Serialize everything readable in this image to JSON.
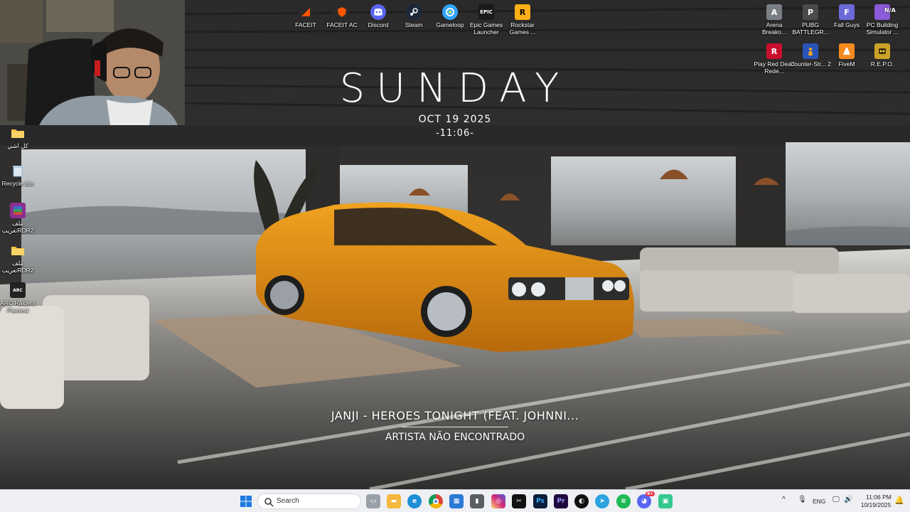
{
  "desktop": {
    "top_icons": [
      {
        "name": "faceit",
        "label": "FACEIT",
        "icon": "faceit-icon",
        "color": "#ff5500"
      },
      {
        "name": "faceit-ac",
        "label": "FACEIT AC",
        "icon": "faceit-ac-icon",
        "color": "#ff5500"
      },
      {
        "name": "discord",
        "label": "Discord",
        "icon": "discord-icon",
        "color": "#5865f2"
      },
      {
        "name": "steam",
        "label": "Steam",
        "icon": "steam-icon",
        "color": "#1b2838"
      },
      {
        "name": "gameloop",
        "label": "Gameloop",
        "icon": "gameloop-icon",
        "color": "#2fa4ff"
      },
      {
        "name": "epic-games",
        "label": "Epic Games Launcher",
        "icon": "epic-games-icon",
        "color": "#1a1a1a"
      },
      {
        "name": "rockstar",
        "label": "Rockstar Games ...",
        "icon": "rockstar-icon",
        "color": "#fcaf17"
      }
    ],
    "right_icons": [
      {
        "name": "arena-breakout",
        "label": "Arena Breako...",
        "icon": "arena-breakout-icon",
        "color": "#7a7f85"
      },
      {
        "name": "pubg",
        "label": "PUBG BATTLEGR...",
        "icon": "pubg-icon",
        "color": "#4a4a48"
      },
      {
        "name": "fall-guys",
        "label": "Fall Guys",
        "icon": "fall-guys-icon",
        "color": "#6a6ad8"
      },
      {
        "name": "pc-building-simulator",
        "label": "PC Building Simulator ...",
        "icon": "pc-building-simulator-icon",
        "color": "#8a5ad8",
        "badge": "N/A"
      },
      {
        "name": "red-dead",
        "label": "Play Red Dead Rede...",
        "icon": "red-dead-icon",
        "color": "#c8102e"
      },
      {
        "name": "counter-strike",
        "label": "Counter-Str... 2",
        "icon": "counter-strike-icon",
        "color": "#2a55b8"
      },
      {
        "name": "fivem",
        "label": "FiveM",
        "icon": "fivem-icon",
        "color": "#f58b1f"
      },
      {
        "name": "repo",
        "label": "R.E.P.O.",
        "icon": "repo-icon",
        "color": "#c9a227"
      }
    ],
    "left_icons": [
      {
        "name": "folder-kol-ashi",
        "label": "كل اشي",
        "icon": "folder-icon",
        "color": "#f5c542"
      },
      {
        "name": "recycle-bin",
        "label": "Recycle Bin",
        "icon": "recycle-bin-icon",
        "color": "#8ab4d8"
      },
      {
        "name": "winrar-rdr2",
        "label": "ملف تعريبRDR2",
        "icon": "winrar-icon",
        "color": "#8b2f8f"
      },
      {
        "name": "folder-rdr2",
        "label": "ملف تعريبRDR2",
        "icon": "folder-icon",
        "color": "#f5c542"
      },
      {
        "name": "arc-raiders",
        "label": "ARC Raiders Playtest",
        "icon": "arc-raiders-icon",
        "color": "#222222"
      }
    ]
  },
  "clock_widget": {
    "day": "SUNDAY",
    "date": "OCT 19 2025",
    "time": "-11:06-"
  },
  "music_widget": {
    "track": "JANJI - HEROES TONIGHT (FEAT. JOHNNI...",
    "artist": "ARTISTA NÃO ENCONTRADO"
  },
  "taskbar": {
    "search_placeholder": "Search",
    "pinned": [
      {
        "name": "task-view",
        "icon": "task-view-icon",
        "color": "#6b6f76"
      },
      {
        "name": "file-explorer",
        "icon": "file-explorer-icon",
        "color": "#f3b83c"
      },
      {
        "name": "edge",
        "icon": "edge-icon",
        "color": "#1d8fd6"
      },
      {
        "name": "chrome",
        "icon": "chrome-icon",
        "color": "#db4437"
      },
      {
        "name": "ms-store",
        "icon": "ms-store-icon",
        "color": "#2a7ad6"
      },
      {
        "name": "usb-device",
        "icon": "usb-icon",
        "color": "#5a5d63"
      },
      {
        "name": "instagram",
        "icon": "instagram-icon",
        "color": "#d6249f"
      },
      {
        "name": "capcut",
        "icon": "capcut-icon",
        "color": "#111111"
      },
      {
        "name": "photoshop",
        "icon": "photoshop-icon",
        "color": "#0b1d3a",
        "text": "Ps"
      },
      {
        "name": "premiere",
        "icon": "premiere-icon",
        "color": "#1f0a3c",
        "text": "Pr"
      },
      {
        "name": "app-blob",
        "icon": "chat-app-icon",
        "color": "#111111"
      },
      {
        "name": "telegram",
        "icon": "telegram-icon",
        "color": "#2aa3e0"
      },
      {
        "name": "spotify",
        "icon": "spotify-icon",
        "color": "#1db954"
      },
      {
        "name": "discord-taskbar",
        "icon": "discord-icon",
        "color": "#5865f2",
        "badge": "9+"
      },
      {
        "name": "android-app",
        "icon": "android-icon",
        "color": "#35c98f"
      }
    ],
    "tray": {
      "language": "ENG",
      "time": "11:06 PM",
      "date": "10/19/2025"
    }
  }
}
